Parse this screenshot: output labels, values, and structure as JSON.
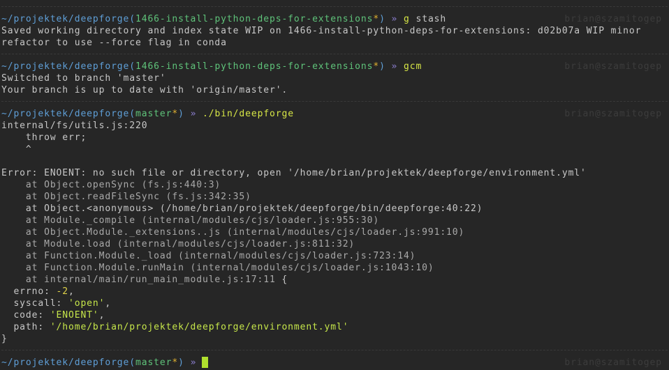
{
  "prompt_common": {
    "path": "~/projektek/deepforge",
    "open_paren": "(",
    "close_paren": ")",
    "star": "*",
    "arrow": "»",
    "userhost": "brian@szamitogep"
  },
  "block1": {
    "branch": "1466-install-python-deps-for-extensions",
    "command": "g",
    "args": "stash",
    "output": [
      "Saved working directory and index state WIP on 1466-install-python-deps-for-extensions: d02b07a WIP minor",
      "refactor to use --force flag in conda"
    ]
  },
  "block2": {
    "branch": "1466-install-python-deps-for-extensions",
    "command": "gcm",
    "output": [
      "Switched to branch 'master'",
      "Your branch is up to date with 'origin/master'."
    ]
  },
  "block3": {
    "branch": "master",
    "command": "./bin/deepforge",
    "output_head": [
      "internal/fs/utils.js:220",
      "    throw err;",
      "    ^",
      "",
      "Error: ENOENT: no such file or directory, open '/home/brian/projektek/deepforge/environment.yml'"
    ],
    "stack": [
      "    at Object.openSync (fs.js:440:3)",
      "    at Object.readFileSync (fs.js:342:35)",
      "    at Object.<anonymous> (/home/brian/projektek/deepforge/bin/deepforge:40:22)",
      "    at Module._compile (internal/modules/cjs/loader.js:955:30)",
      "    at Object.Module._extensions..js (internal/modules/cjs/loader.js:991:10)",
      "    at Module.load (internal/modules/cjs/loader.js:811:32)",
      "    at Function.Module._load (internal/modules/cjs/loader.js:723:14)",
      "    at Function.Module.runMain (internal/modules/cjs/loader.js:1043:10)",
      "    at internal/main/run_main_module.js:17:11"
    ],
    "stack_tail": " {",
    "props": [
      {
        "key": "  errno: ",
        "value": "-2",
        "type": "num",
        "suffix": ","
      },
      {
        "key": "  syscall: ",
        "value": "'open'",
        "type": "str",
        "suffix": ","
      },
      {
        "key": "  code: ",
        "value": "'ENOENT'",
        "type": "str",
        "suffix": ","
      },
      {
        "key": "  path: ",
        "value": "'/home/brian/projektek/deepforge/environment.yml'",
        "type": "str",
        "suffix": ""
      }
    ],
    "closing": "}"
  },
  "block4": {
    "branch": "master"
  }
}
